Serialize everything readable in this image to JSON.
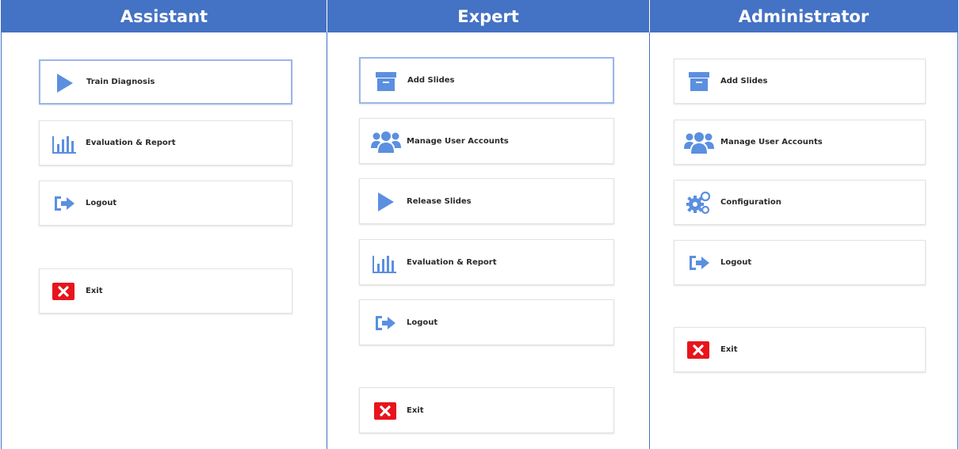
{
  "columns": [
    {
      "title": "Assistant",
      "buttons": [
        {
          "label": "Train Diagnosis",
          "icon": "play-icon",
          "selected": true
        },
        {
          "label": "Evaluation & Report",
          "icon": "bar-chart-icon"
        },
        {
          "label": "Logout",
          "icon": "logout-icon"
        },
        {
          "label": "Exit",
          "icon": "exit-icon"
        }
      ]
    },
    {
      "title": "Expert",
      "buttons": [
        {
          "label": "Add Slides",
          "icon": "archive-box-icon",
          "selected": true
        },
        {
          "label": "Manage User Accounts",
          "icon": "users-icon"
        },
        {
          "label": "Release Slides",
          "icon": "play-icon"
        },
        {
          "label": "Evaluation & Report",
          "icon": "bar-chart-icon"
        },
        {
          "label": "Logout",
          "icon": "logout-icon"
        },
        {
          "label": "Exit",
          "icon": "exit-icon"
        }
      ]
    },
    {
      "title": "Administrator",
      "buttons": [
        {
          "label": "Add Slides",
          "icon": "archive-box-icon"
        },
        {
          "label": "Manage User Accounts",
          "icon": "users-icon"
        },
        {
          "label": "Configuration",
          "icon": "gears-icon"
        },
        {
          "label": "Logout",
          "icon": "logout-icon"
        },
        {
          "label": "Exit",
          "icon": "exit-icon"
        }
      ]
    }
  ],
  "colors": {
    "header_bg": "#4472c4",
    "icon_blue": "#5b8fe0",
    "exit_red": "#e8141c"
  }
}
